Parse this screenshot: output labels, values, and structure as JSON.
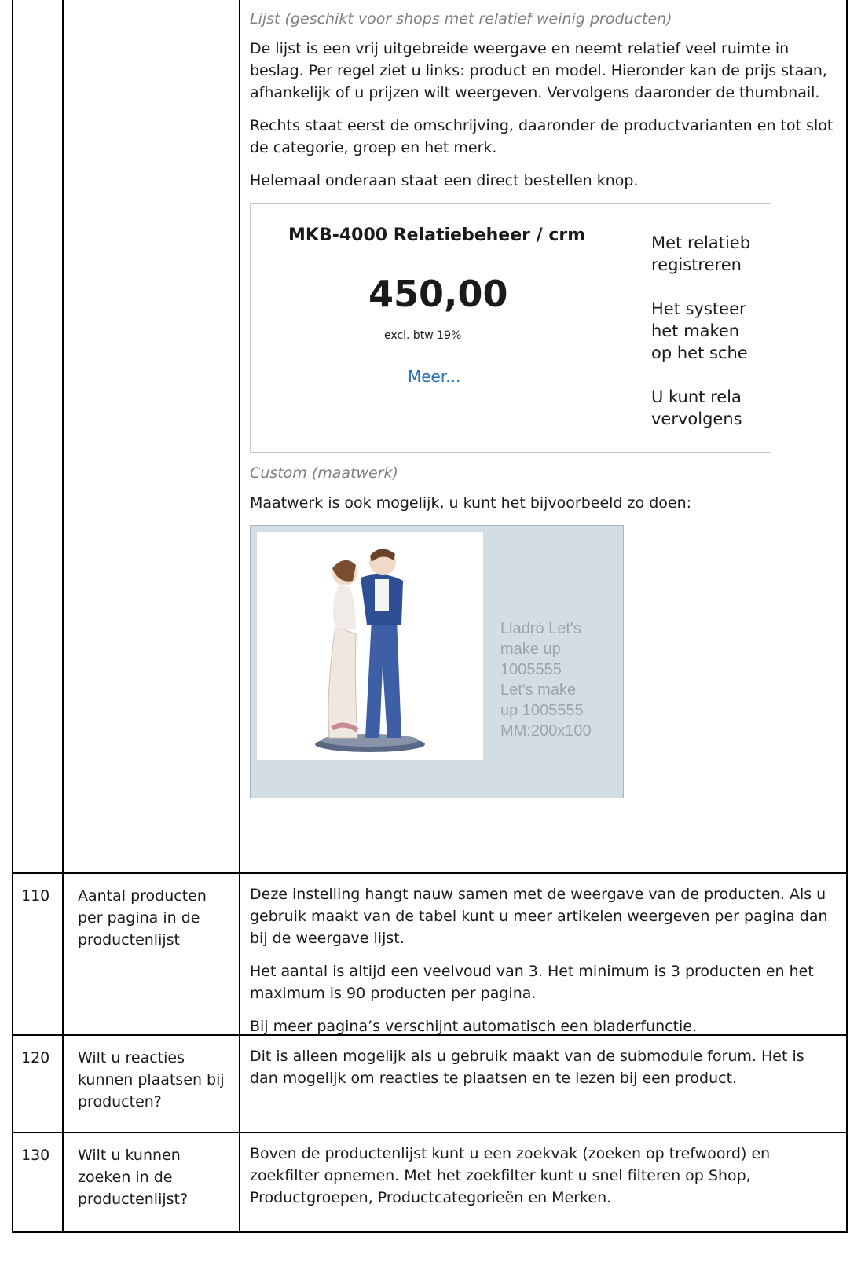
{
  "row_top": {
    "desc": {
      "lijst_heading": "Lijst (geschikt voor shops met relatief weinig producten)",
      "p1": "De lijst is een vrij uitgebreide weergave en neemt relatief veel ruimte in beslag. Per regel ziet u links: product en model. Hieronder kan de prijs staan, afhankelijk of u prijzen wilt weergeven. Vervolgens daaronder de thumbnail.",
      "p2": "Rechts staat eerst de omschrijving, daaronder de productvarianten en tot slot de categorie, groep en het merk.",
      "p3": "Helemaal onderaan staat een direct bestellen knop.",
      "card": {
        "title": "MKB-4000 Relatiebeheer / crm",
        "price": "450,00",
        "vat": "excl. btw 19%",
        "more": "Meer...",
        "desc_lines": "Met relatieb\nregistreren\n\nHet systeer\nhet maken\nop het sche\n\nU kunt rela\nvervolgens"
      },
      "custom_heading": "Custom (maatwerk)",
      "p4": "Maatwerk is ook mogelijk, u kunt het bijvoorbeeld zo doen:",
      "figure_caption": "Lladró Let's\nmake up\n1005555\nLet's make\nup 1005555\nMM:200x100"
    }
  },
  "rows": [
    {
      "num": "110",
      "setting": "Aantal producten per pagina in de productenlijst",
      "p1": "Deze instelling hangt nauw samen met de weergave van de producten. Als u gebruik maakt van de tabel kunt u meer artikelen weergeven per pagina dan bij de weergave lijst.",
      "p2": "Het aantal is altijd een veelvoud van 3. Het minimum is 3 producten en het maximum is 90 producten per pagina.",
      "p3": "Bij meer pagina’s verschijnt automatisch een bladerfunctie."
    },
    {
      "num": "120",
      "setting": "Wilt u reacties kunnen plaatsen bij producten?",
      "p1": "Dit is alleen mogelijk als u gebruik maakt van de submodule forum. Het is dan mogelijk om reacties te plaatsen en te lezen bij een product."
    },
    {
      "num": "130",
      "setting": "Wilt u kunnen zoeken in de productenlijst?",
      "p1": "Boven de productenlijst kunt u een zoekvak (zoeken op trefwoord) en zoekfilter opnemen. Met het zoekfilter kunt u snel filteren op Shop, Productgroepen, Productcategorieën en Merken."
    }
  ]
}
